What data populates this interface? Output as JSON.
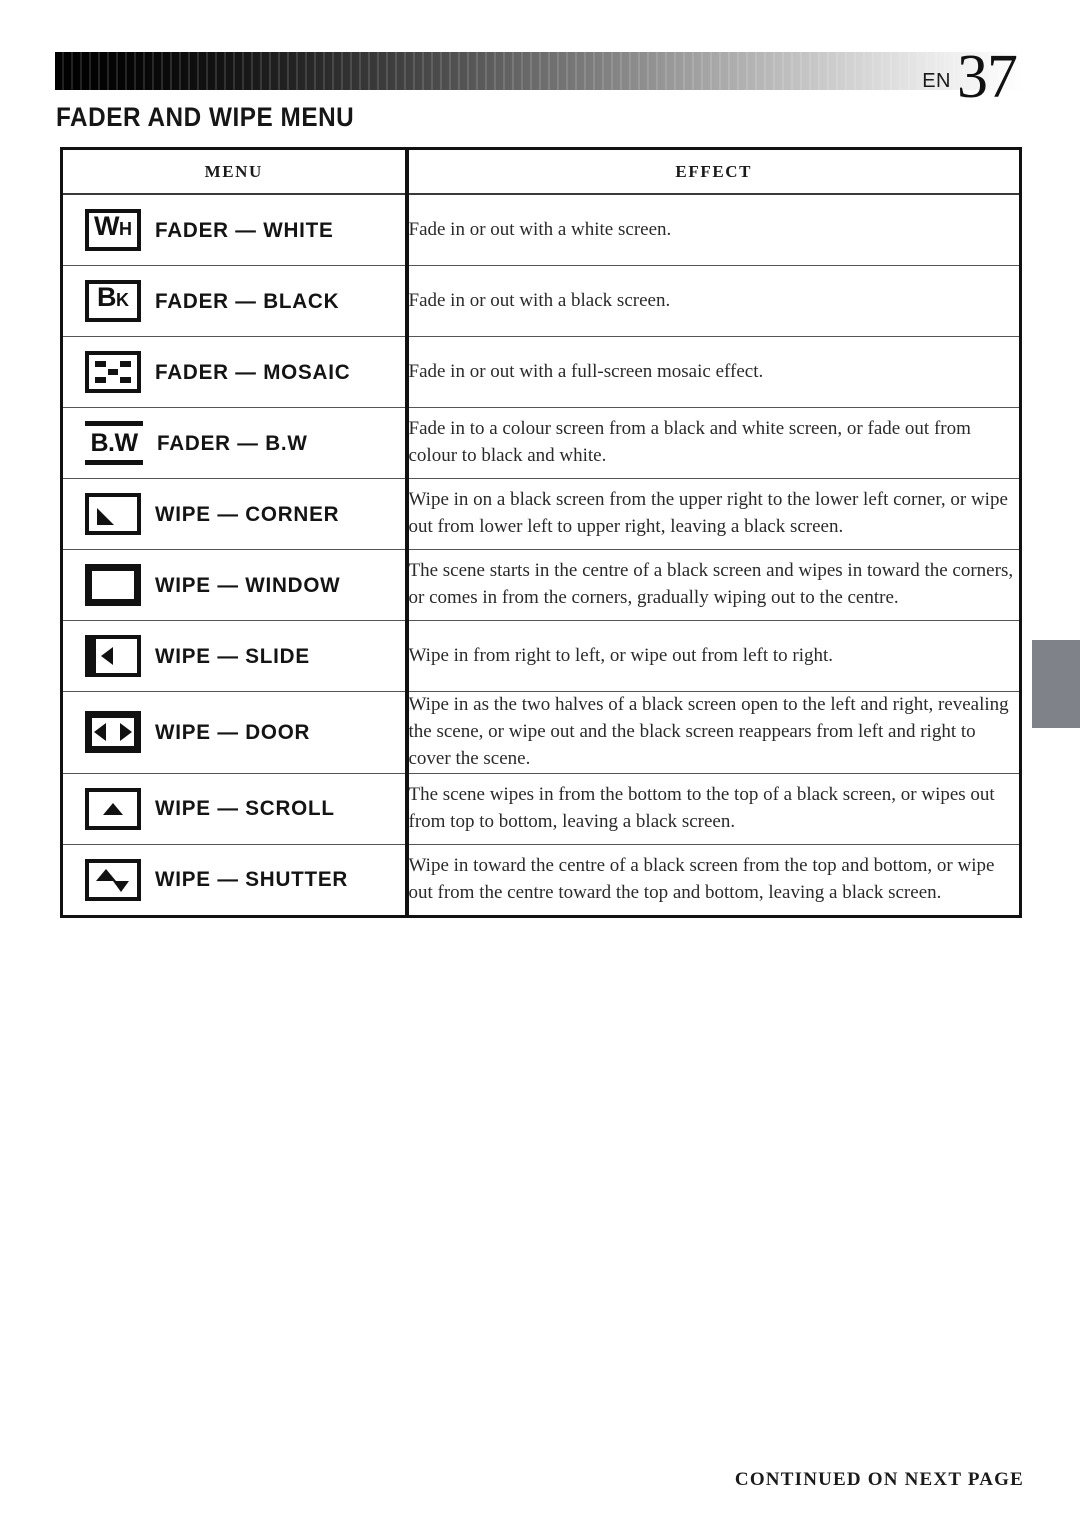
{
  "header": {
    "lang_code": "EN",
    "page_number": "37",
    "section_title": "FADER AND WIPE MENU"
  },
  "table": {
    "columns": [
      "MENU",
      "EFFECT"
    ],
    "rows": [
      {
        "icon": "wh-badge-icon",
        "icon_text": {
          "big": "W",
          "small": "H"
        },
        "menu": "FADER — WHITE",
        "effect": "Fade in or out with a white screen."
      },
      {
        "icon": "bk-badge-icon",
        "icon_text": {
          "big": "B",
          "small": "K"
        },
        "menu": "FADER — BLACK",
        "effect": "Fade in or out with a black screen."
      },
      {
        "icon": "mosaic-icon",
        "menu": "FADER — MOSAIC",
        "effect": "Fade in or out with a full-screen mosaic effect."
      },
      {
        "icon": "bw-badge-icon",
        "icon_text": {
          "label": "B.W"
        },
        "menu": "FADER — B.W",
        "effect": "Fade in to a colour screen from a black and white screen, or fade out from colour to black and white."
      },
      {
        "icon": "wipe-corner-icon",
        "menu": "WIPE — CORNER",
        "effect": "Wipe in on a black screen from the upper right to the lower left corner, or wipe out from lower left to upper right, leaving a black screen."
      },
      {
        "icon": "wipe-window-icon",
        "menu": "WIPE — WINDOW",
        "effect": "The scene starts in the centre of a black screen and wipes in toward the corners, or comes in from the corners, gradually wiping out to the centre."
      },
      {
        "icon": "wipe-slide-icon",
        "menu": "WIPE — SLIDE",
        "effect": "Wipe in from right to left, or wipe out from left to right."
      },
      {
        "icon": "wipe-door-icon",
        "menu": "WIPE — DOOR",
        "effect": "Wipe in as the two halves of a black screen open to the left and right, revealing the scene, or wipe out and the black screen reappears from left and right to cover the scene."
      },
      {
        "icon": "wipe-scroll-icon",
        "menu": "WIPE — SCROLL",
        "effect": "The scene wipes in from the bottom to the top of a black screen, or wipes out from top to bottom, leaving a black screen."
      },
      {
        "icon": "wipe-shutter-icon",
        "menu": "WIPE — SHUTTER",
        "effect": "Wipe in toward the centre of a black screen from the top and bottom, or wipe out from the centre toward the top and bottom, leaving a black screen."
      }
    ]
  },
  "footer": {
    "note": "CONTINUED ON NEXT PAGE"
  },
  "colors": {
    "ink": "#111111",
    "edge_tab_gray": "#80828a"
  }
}
